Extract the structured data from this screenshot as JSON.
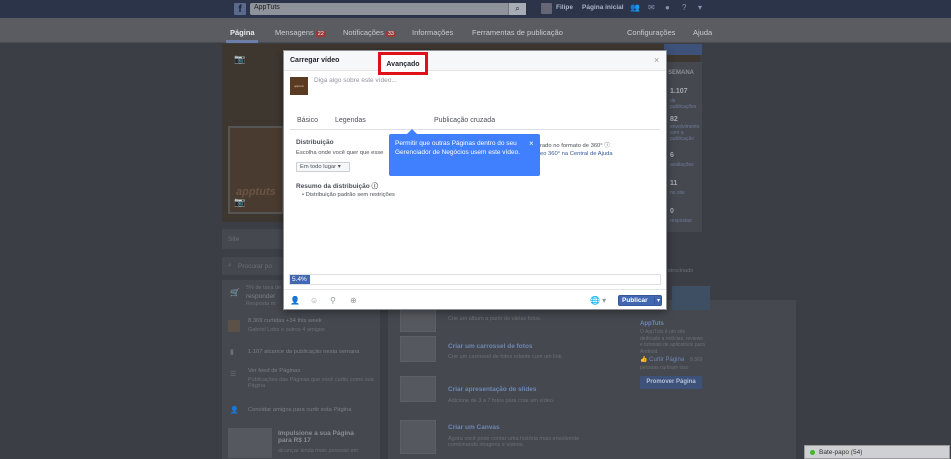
{
  "topbar": {
    "search_value": "AppTuts",
    "user_name": "Filipe",
    "home_link": "Página inicial",
    "help_link": "Ajuda"
  },
  "page_nav": {
    "tabs": [
      {
        "label": "Página"
      },
      {
        "label": "Mensagens",
        "badge": "22"
      },
      {
        "label": "Notificações",
        "badge": "33"
      },
      {
        "label": "Informações"
      },
      {
        "label": "Ferramentas de publicação"
      }
    ],
    "settings": "Configurações",
    "help": "Ajuda"
  },
  "background": {
    "profile_text": "apptuts",
    "left": {
      "site": "Site",
      "search_placeholder": "Procurar po",
      "response_rate": "5% de taxa de",
      "response_sub": "responder",
      "response_time": "Resposta m",
      "likes": "8.369 curtidas +34 this week",
      "likes_sub": "Gabriel Lobo e outros 4 amigos",
      "reach": "1.107 alcance da publicação nesta semana",
      "feed": "Ver feed de Páginas",
      "feed_sub": "Publicações das Páginas que você curtiu como sua Página",
      "invite": "Convidar amigos para curtir esta Página",
      "boost_title": "Impulsione a sua Página para R$ 17",
      "boost_sub": "alcançar ainda mais pessoas em"
    },
    "mid": [
      {
        "title": "",
        "sub": "Crie um álbum a partir de várias fotos."
      },
      {
        "title": "Criar um carrossel de fotos",
        "sub": "Crie um carrossel de fotos rolante com um link."
      },
      {
        "title": "Criar apresentação de slides",
        "sub": "Adicione de 3 a 7 fotos para criar um vídeo."
      },
      {
        "title": "Criar um Canvas",
        "sub": "Agora você pode contar uma história mais envolvente combinando imagens e vídeos."
      }
    ],
    "right": {
      "week_label": "SEMANA",
      "stats": [
        {
          "value": "1.107",
          "label": "de publicações"
        },
        {
          "value": "82",
          "label": "envolvimento com a publicação"
        },
        {
          "value": "6",
          "label": "avaliações"
        },
        {
          "value": "11",
          "label": "no site"
        },
        {
          "value": "0",
          "label": "respostas"
        }
      ],
      "sponsored": "Patrocinado",
      "app_name": "AppTuts",
      "app_desc": "O AppTuts é um site dedicado a notícias, reviews e tutoriais de aplicativos para Android.",
      "like_page": "Curtir Página",
      "like_count": "8.369",
      "like_sub": "pessoas curtiram isso",
      "promote_button": "Promover Página"
    },
    "chat": "Bate-papo (54)"
  },
  "modal": {
    "title": "Carregar vídeo",
    "compose_placeholder": "Diga algo sobre este vídeo...",
    "thumb_text": "apptuts",
    "tabs": {
      "basic": "Básico",
      "captions": "Legendas",
      "advanced": "Avançado",
      "crosspost": "Publicação cruzada"
    },
    "distribution_label": "Distribuição",
    "distribution_text": "Escolha onde você quer que esse",
    "distribution_select": "Em todo lugar",
    "right_text_1": "rado no formato de 360°",
    "right_text_2": "eo 360° na Central de Ajuda",
    "tooltip": "Permitir que outras Páginas dentro do seu Gerenciador de Negócios usem este vídeo.",
    "summary_label": "Resumo da distribuição",
    "summary_item": "Distribuição padrão sem restrições",
    "progress_label": "5.4%",
    "progress_value": 0.054,
    "publish_button": "Publicar"
  }
}
